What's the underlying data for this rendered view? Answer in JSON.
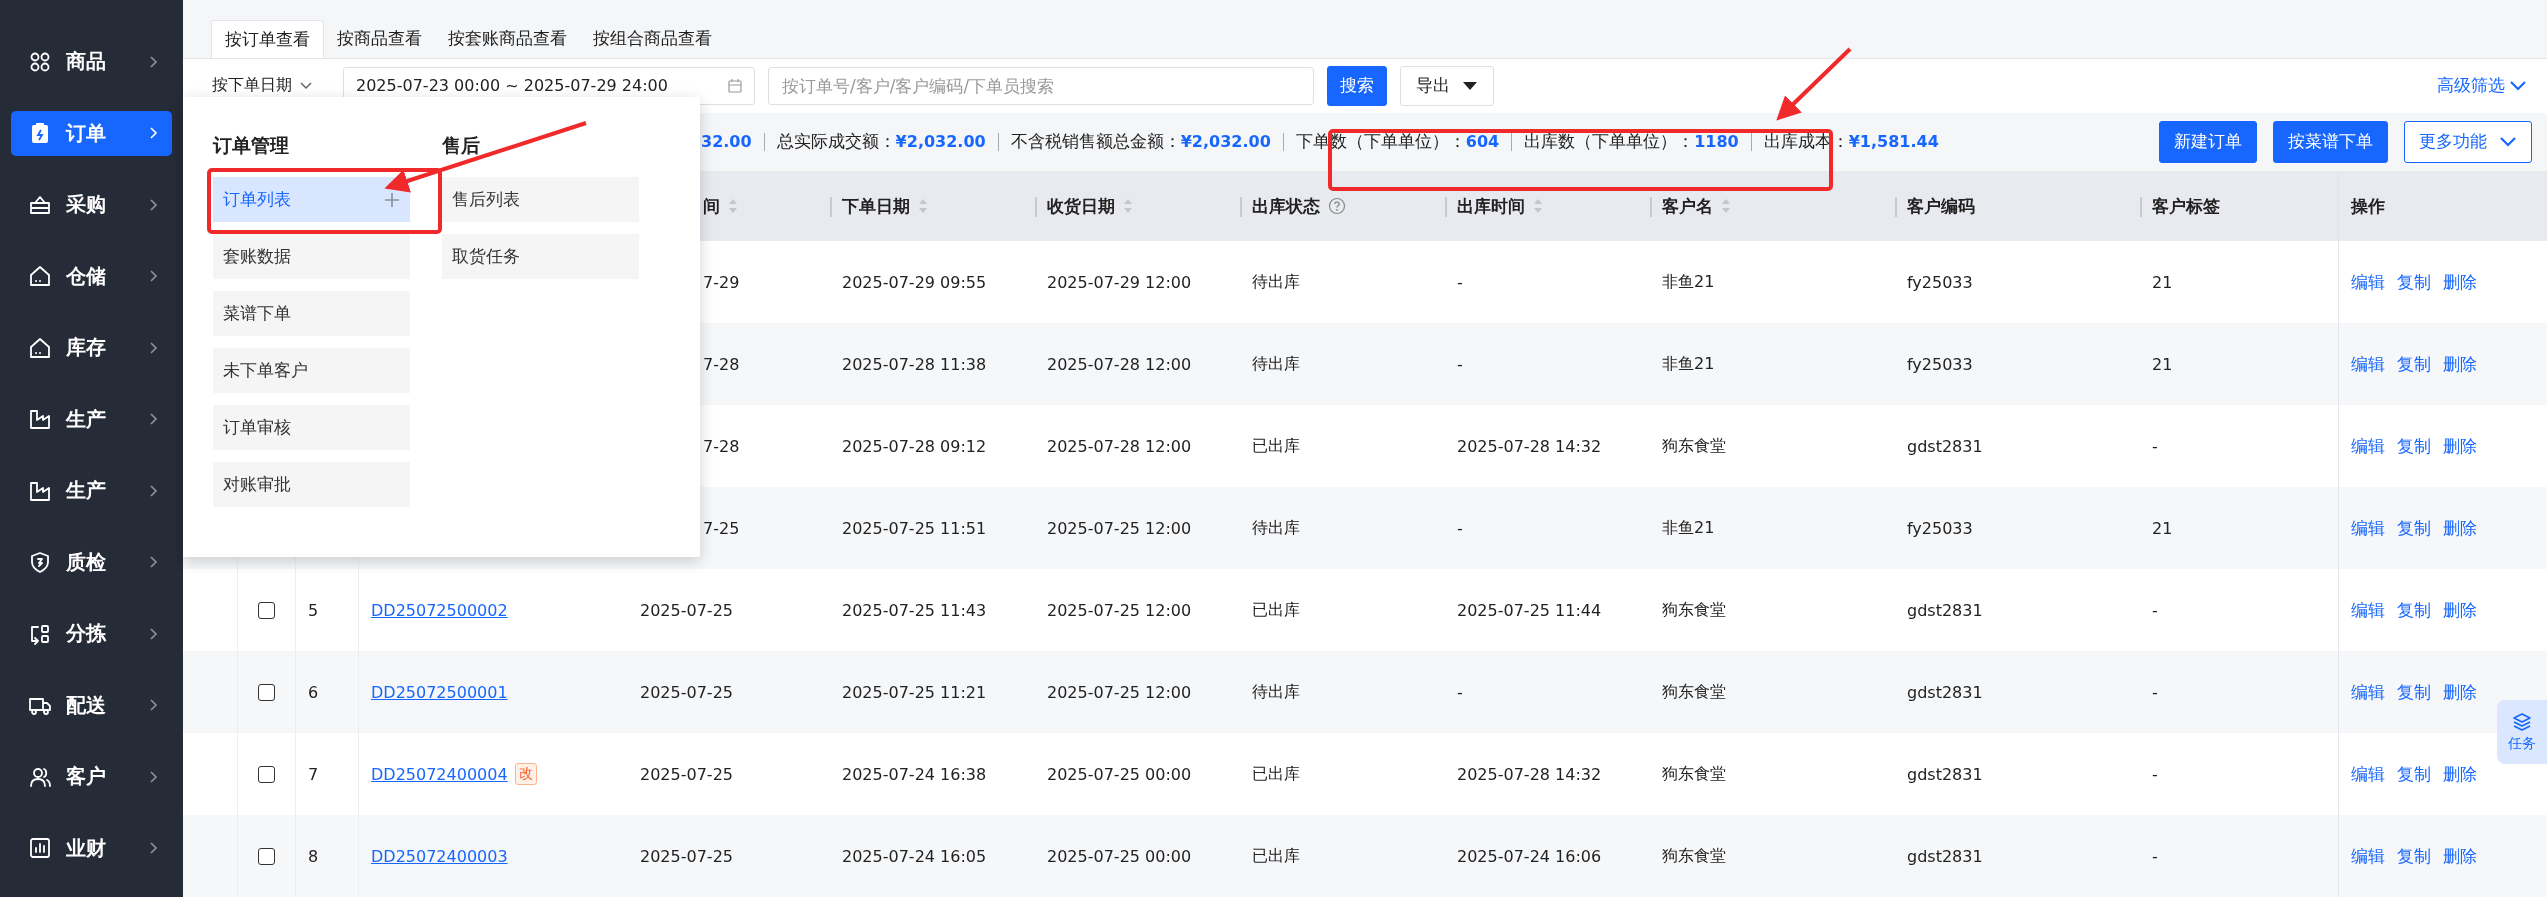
{
  "sidebar": {
    "items": [
      {
        "label": "商品",
        "selected": false
      },
      {
        "label": "订单",
        "selected": true
      },
      {
        "label": "采购",
        "selected": false
      },
      {
        "label": "仓储",
        "selected": false
      },
      {
        "label": "库存",
        "selected": false
      },
      {
        "label": "生产",
        "selected": false
      },
      {
        "label": "生产",
        "selected": false
      },
      {
        "label": "质检",
        "selected": false
      },
      {
        "label": "分拣",
        "selected": false
      },
      {
        "label": "配送",
        "selected": false
      },
      {
        "label": "客户",
        "selected": false
      },
      {
        "label": "业财",
        "selected": false
      }
    ]
  },
  "view_tabs": [
    {
      "label": "按订单查看",
      "selected": true
    },
    {
      "label": "按商品查看",
      "selected": false
    },
    {
      "label": "按套账商品查看",
      "selected": false
    },
    {
      "label": "按组合商品查看",
      "selected": false
    }
  ],
  "filter": {
    "date_type": "按下单日期",
    "date_range": "2025-07-23 00:00 ~ 2025-07-29 24:00",
    "search": {
      "placeholder": "按订单号/客户/客户编码/下单员搜索"
    },
    "search_button": "搜索",
    "export_button": "导出",
    "advanced_filter": "高级筛选"
  },
  "stats": [
    {
      "value": "32.00"
    },
    {
      "label": "总实际成交额：",
      "value": "¥2,032.00"
    },
    {
      "label": "不含税销售额总金额：",
      "value": "¥2,032.00"
    },
    {
      "label": "下单数（下单单位）：",
      "value": "604"
    },
    {
      "label": "出库数（下单单位）：",
      "value": "1180"
    },
    {
      "label": "出库成本：",
      "value": "¥1,581.44"
    }
  ],
  "actions": [
    {
      "label": "新建订单",
      "kind": "primary"
    },
    {
      "label": "按菜谱下单",
      "kind": "primary"
    },
    {
      "label": "更多功能",
      "kind": "dropdown"
    }
  ],
  "table": {
    "columns": [
      {
        "label": "间",
        "sortable": true,
        "help": false
      },
      {
        "label": "下单日期",
        "sortable": true,
        "help": false
      },
      {
        "label": "收货日期",
        "sortable": true,
        "help": false
      },
      {
        "label": "出库状态",
        "sortable": false,
        "help": true
      },
      {
        "label": "出库时间",
        "sortable": true,
        "help": false
      },
      {
        "label": "客户名",
        "sortable": true,
        "help": false
      },
      {
        "label": "客户编码",
        "sortable": false,
        "help": false
      },
      {
        "label": "客户标签",
        "sortable": false,
        "help": false
      },
      {
        "label": "操作",
        "sortable": false,
        "help": false
      }
    ],
    "rows": [
      {
        "column_4": "7-29",
        "order_date": "2025-07-29 09:55",
        "receive_date": "2025-07-29 12:00",
        "status": "待出库",
        "out_time": "-",
        "customer": "非鱼21",
        "customer_code": "fy25033",
        "customer_tag": "21",
        "actions": [
          "编辑",
          "复制",
          "删除"
        ]
      },
      {
        "column_4": "7-28",
        "order_date": "2025-07-28 11:38",
        "receive_date": "2025-07-28 12:00",
        "status": "待出库",
        "out_time": "-",
        "customer": "非鱼21",
        "customer_code": "fy25033",
        "customer_tag": "21",
        "actions": [
          "编辑",
          "复制",
          "删除"
        ]
      },
      {
        "column_4": "7-28",
        "order_date": "2025-07-28 09:12",
        "receive_date": "2025-07-28 12:00",
        "status": "已出库",
        "out_time": "2025-07-28 14:32",
        "customer": "狗东食堂",
        "customer_code": "gdst2831",
        "customer_tag": "-",
        "actions": [
          "编辑",
          "复制",
          "删除"
        ]
      },
      {
        "column_4": "7-25",
        "order_date": "2025-07-25 11:51",
        "receive_date": "2025-07-25 12:00",
        "status": "待出库",
        "out_time": "-",
        "customer": "非鱼21",
        "customer_code": "fy25033",
        "customer_tag": "21",
        "actions": [
          "编辑",
          "复制",
          "删除"
        ]
      },
      {
        "checked": false,
        "number": "5",
        "order_no": "DD25072500002",
        "column_4": "2025-07-25",
        "order_date": "2025-07-25 11:43",
        "receive_date": "2025-07-25 12:00",
        "status": "已出库",
        "out_time": "2025-07-25 11:44",
        "customer": "狗东食堂",
        "customer_code": "gdst2831",
        "customer_tag": "-",
        "actions": [
          "编辑",
          "复制",
          "删除"
        ]
      },
      {
        "checked": false,
        "number": "6",
        "order_no": "DD25072500001",
        "column_4": "2025-07-25",
        "order_date": "2025-07-25 11:21",
        "receive_date": "2025-07-25 12:00",
        "status": "待出库",
        "out_time": "-",
        "customer": "狗东食堂",
        "customer_code": "gdst2831",
        "customer_tag": "-",
        "actions": [
          "编辑",
          "复制",
          "删除"
        ]
      },
      {
        "checked": false,
        "number": "7",
        "order_no": "DD25072400004",
        "badge": "改",
        "column_4": "2025-07-25",
        "order_date": "2025-07-24 16:38",
        "receive_date": "2025-07-25 00:00",
        "status": "已出库",
        "out_time": "2025-07-28 14:32",
        "customer": "狗东食堂",
        "customer_code": "gdst2831",
        "customer_tag": "-",
        "actions": [
          "编辑",
          "复制",
          "删除"
        ]
      },
      {
        "checked": false,
        "number": "8",
        "order_no": "DD25072400003",
        "column_4": "2025-07-25",
        "order_date": "2025-07-24 16:05",
        "receive_date": "2025-07-25 00:00",
        "status": "已出库",
        "out_time": "2025-07-24 16:06",
        "customer": "狗东食堂",
        "customer_code": "gdst2831",
        "customer_tag": "-",
        "actions": [
          "编辑",
          "复制",
          "删除"
        ]
      }
    ]
  },
  "menu": {
    "groups": [
      {
        "title": "订单管理",
        "items": [
          {
            "label": "订单列表",
            "selected": true
          },
          {
            "label": "套账数据",
            "selected": false
          },
          {
            "label": "菜谱下单",
            "selected": false
          },
          {
            "label": "未下单客户",
            "selected": false
          },
          {
            "label": "订单审核",
            "selected": false
          },
          {
            "label": "对账审批",
            "selected": false
          }
        ]
      },
      {
        "title": "售后",
        "items": [
          {
            "label": "售后列表",
            "selected": false
          },
          {
            "label": "取货任务",
            "selected": false
          }
        ]
      }
    ]
  },
  "task_tab": {
    "label": "任务"
  }
}
